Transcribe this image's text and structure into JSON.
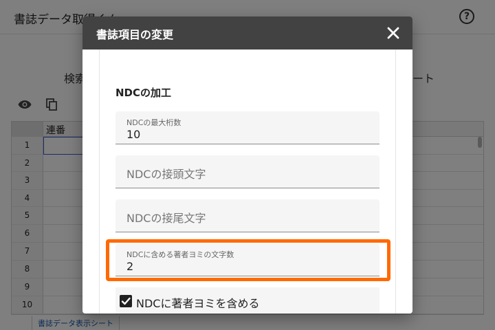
{
  "app": {
    "title": "書誌データ取得くん",
    "help_symbol": "?",
    "tab_left": "検索",
    "tab_right": "ート"
  },
  "grid": {
    "column_header": "連番",
    "row_numbers": [
      "1",
      "2",
      "3",
      "4",
      "5",
      "6",
      "7",
      "8",
      "9",
      "10"
    ],
    "sheet_tab": "書誌データ表示シート"
  },
  "dialog": {
    "title": "書誌項目の変更",
    "close_icon": "close-icon",
    "section_title": "NDCの加工",
    "fields": {
      "max_digits": {
        "label": "NDCの最大桁数",
        "value": "10"
      },
      "prefix": {
        "placeholder": "NDCの接頭文字"
      },
      "suffix": {
        "placeholder": "NDCの接尾文字"
      },
      "author_kana_chars": {
        "label": "NDCに含める著者ヨミの文字数",
        "value": "2"
      }
    },
    "checkbox": {
      "label": "NDCに著者ヨミを含める",
      "checked": true
    }
  },
  "colors": {
    "dialog_header": "#424242",
    "highlight": "#ff6a00",
    "field_bg": "#f5f5f5"
  }
}
